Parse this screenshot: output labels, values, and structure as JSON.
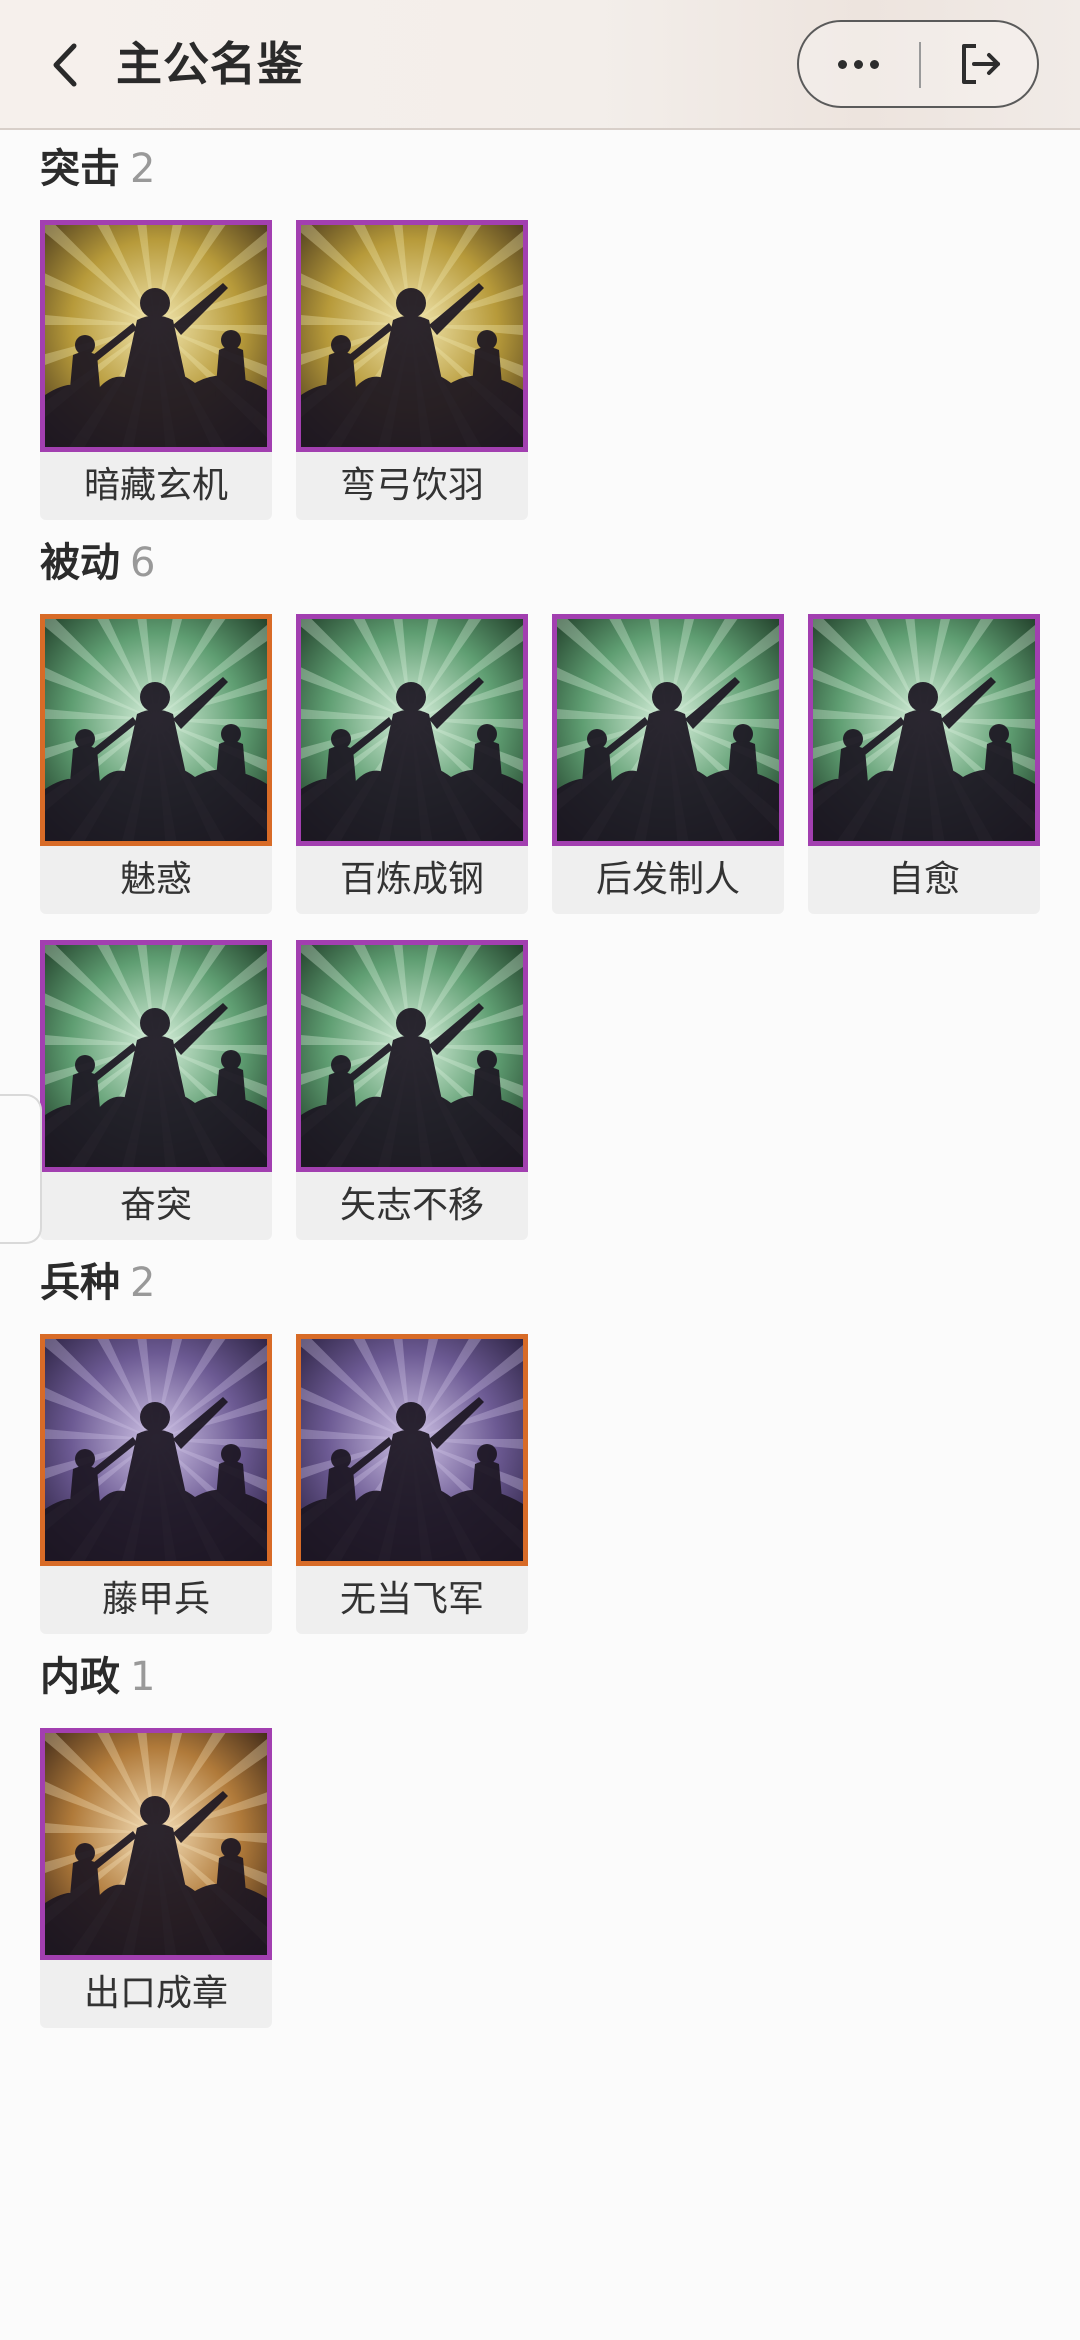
{
  "header": {
    "title": "主公名鉴"
  },
  "sections": [
    {
      "title": "突击",
      "count": "2",
      "cards": [
        {
          "label": "暗藏玄机",
          "frame": "purple",
          "theme": "gold"
        },
        {
          "label": "弯弓饮羽",
          "frame": "purple",
          "theme": "gold"
        }
      ]
    },
    {
      "title": "被动",
      "count": "6",
      "cards": [
        {
          "label": "魅惑",
          "frame": "orange",
          "theme": "green"
        },
        {
          "label": "百炼成钢",
          "frame": "purple",
          "theme": "green"
        },
        {
          "label": "后发制人",
          "frame": "purple",
          "theme": "green"
        },
        {
          "label": "自愈",
          "frame": "purple",
          "theme": "green"
        },
        {
          "label": "奋突",
          "frame": "purple",
          "theme": "green"
        },
        {
          "label": "矢志不移",
          "frame": "purple",
          "theme": "green"
        }
      ]
    },
    {
      "title": "兵种",
      "count": "2",
      "cards": [
        {
          "label": "藤甲兵",
          "frame": "orange",
          "theme": "violet"
        },
        {
          "label": "无当飞军",
          "frame": "orange",
          "theme": "violet"
        }
      ]
    },
    {
      "title": "内政",
      "count": "1",
      "cards": [
        {
          "label": "出口成章",
          "frame": "purple",
          "theme": "amber"
        }
      ]
    }
  ],
  "colors": {
    "frame_purple": "#a23fb0",
    "frame_orange": "#d86b27"
  }
}
